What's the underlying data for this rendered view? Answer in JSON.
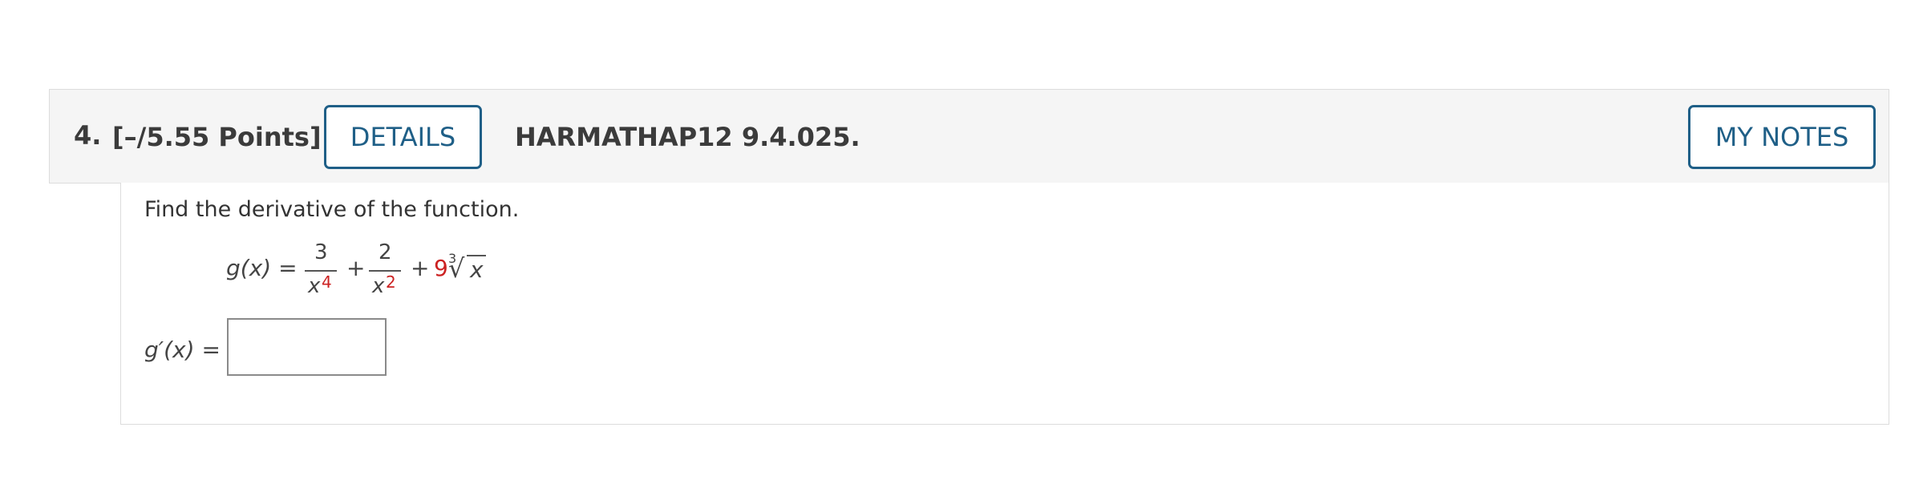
{
  "question": {
    "number": "4.",
    "points": "[–/5.55 Points]",
    "details_label": "DETAILS",
    "problem_id": "HARMATHAP12 9.4.025.",
    "notes_label": "MY NOTES"
  },
  "content": {
    "prompt": "Find the derivative of the function.",
    "function": {
      "lhs": "g(x) =",
      "term1_num": "3",
      "term1_den": "x",
      "term1_exp": "4",
      "plus1": "+",
      "term2_num": "2",
      "term2_den": "x",
      "term2_exp": "2",
      "plus2": "+",
      "coef": "9",
      "root_index": "3",
      "radical": "√",
      "radicand": "x"
    },
    "answer_label": "g′(x) =",
    "answer_value": ""
  },
  "colors": {
    "accent": "#1f5f87",
    "highlight": "#cc2222",
    "header_bg": "#f5f5f5"
  }
}
